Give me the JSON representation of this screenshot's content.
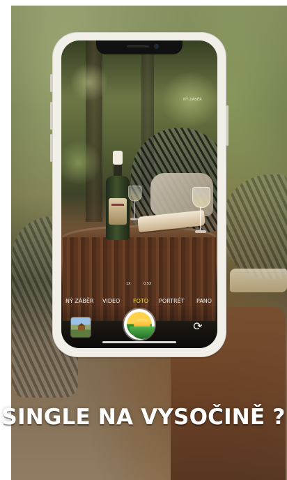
{
  "camera": {
    "top_hint": "NÝ ZÁBĚR",
    "mini_controls": {
      "left": "1X",
      "right": "0.5X"
    },
    "modes": [
      {
        "label": "NÝ ZÁBĚR"
      },
      {
        "label": "VIDEO"
      },
      {
        "label": "FOTO"
      },
      {
        "label": "PORTRÉT"
      },
      {
        "label": "PANO"
      }
    ],
    "selected_mode": "FOTO",
    "icons": {
      "switch_camera": "rotate-icon"
    }
  },
  "caption": {
    "text": "SINGLE NA VYSOČINĚ ?"
  },
  "colors": {
    "selected_mode": "#f8dc58",
    "caption": "#ffffff"
  }
}
